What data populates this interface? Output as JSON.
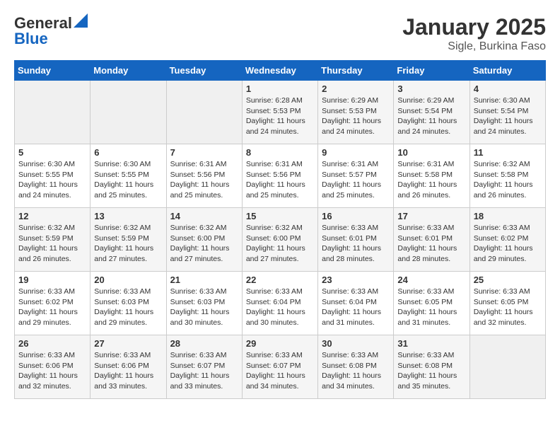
{
  "header": {
    "logo_line1": "General",
    "logo_line2": "Blue",
    "month": "January 2025",
    "location": "Sigle, Burkina Faso"
  },
  "days_of_week": [
    "Sunday",
    "Monday",
    "Tuesday",
    "Wednesday",
    "Thursday",
    "Friday",
    "Saturday"
  ],
  "weeks": [
    [
      {
        "day": "",
        "info": ""
      },
      {
        "day": "",
        "info": ""
      },
      {
        "day": "",
        "info": ""
      },
      {
        "day": "1",
        "info": "Sunrise: 6:28 AM\nSunset: 5:53 PM\nDaylight: 11 hours and 24 minutes."
      },
      {
        "day": "2",
        "info": "Sunrise: 6:29 AM\nSunset: 5:53 PM\nDaylight: 11 hours and 24 minutes."
      },
      {
        "day": "3",
        "info": "Sunrise: 6:29 AM\nSunset: 5:54 PM\nDaylight: 11 hours and 24 minutes."
      },
      {
        "day": "4",
        "info": "Sunrise: 6:30 AM\nSunset: 5:54 PM\nDaylight: 11 hours and 24 minutes."
      }
    ],
    [
      {
        "day": "5",
        "info": "Sunrise: 6:30 AM\nSunset: 5:55 PM\nDaylight: 11 hours and 24 minutes."
      },
      {
        "day": "6",
        "info": "Sunrise: 6:30 AM\nSunset: 5:55 PM\nDaylight: 11 hours and 25 minutes."
      },
      {
        "day": "7",
        "info": "Sunrise: 6:31 AM\nSunset: 5:56 PM\nDaylight: 11 hours and 25 minutes."
      },
      {
        "day": "8",
        "info": "Sunrise: 6:31 AM\nSunset: 5:56 PM\nDaylight: 11 hours and 25 minutes."
      },
      {
        "day": "9",
        "info": "Sunrise: 6:31 AM\nSunset: 5:57 PM\nDaylight: 11 hours and 25 minutes."
      },
      {
        "day": "10",
        "info": "Sunrise: 6:31 AM\nSunset: 5:58 PM\nDaylight: 11 hours and 26 minutes."
      },
      {
        "day": "11",
        "info": "Sunrise: 6:32 AM\nSunset: 5:58 PM\nDaylight: 11 hours and 26 minutes."
      }
    ],
    [
      {
        "day": "12",
        "info": "Sunrise: 6:32 AM\nSunset: 5:59 PM\nDaylight: 11 hours and 26 minutes."
      },
      {
        "day": "13",
        "info": "Sunrise: 6:32 AM\nSunset: 5:59 PM\nDaylight: 11 hours and 27 minutes."
      },
      {
        "day": "14",
        "info": "Sunrise: 6:32 AM\nSunset: 6:00 PM\nDaylight: 11 hours and 27 minutes."
      },
      {
        "day": "15",
        "info": "Sunrise: 6:32 AM\nSunset: 6:00 PM\nDaylight: 11 hours and 27 minutes."
      },
      {
        "day": "16",
        "info": "Sunrise: 6:33 AM\nSunset: 6:01 PM\nDaylight: 11 hours and 28 minutes."
      },
      {
        "day": "17",
        "info": "Sunrise: 6:33 AM\nSunset: 6:01 PM\nDaylight: 11 hours and 28 minutes."
      },
      {
        "day": "18",
        "info": "Sunrise: 6:33 AM\nSunset: 6:02 PM\nDaylight: 11 hours and 29 minutes."
      }
    ],
    [
      {
        "day": "19",
        "info": "Sunrise: 6:33 AM\nSunset: 6:02 PM\nDaylight: 11 hours and 29 minutes."
      },
      {
        "day": "20",
        "info": "Sunrise: 6:33 AM\nSunset: 6:03 PM\nDaylight: 11 hours and 29 minutes."
      },
      {
        "day": "21",
        "info": "Sunrise: 6:33 AM\nSunset: 6:03 PM\nDaylight: 11 hours and 30 minutes."
      },
      {
        "day": "22",
        "info": "Sunrise: 6:33 AM\nSunset: 6:04 PM\nDaylight: 11 hours and 30 minutes."
      },
      {
        "day": "23",
        "info": "Sunrise: 6:33 AM\nSunset: 6:04 PM\nDaylight: 11 hours and 31 minutes."
      },
      {
        "day": "24",
        "info": "Sunrise: 6:33 AM\nSunset: 6:05 PM\nDaylight: 11 hours and 31 minutes."
      },
      {
        "day": "25",
        "info": "Sunrise: 6:33 AM\nSunset: 6:05 PM\nDaylight: 11 hours and 32 minutes."
      }
    ],
    [
      {
        "day": "26",
        "info": "Sunrise: 6:33 AM\nSunset: 6:06 PM\nDaylight: 11 hours and 32 minutes."
      },
      {
        "day": "27",
        "info": "Sunrise: 6:33 AM\nSunset: 6:06 PM\nDaylight: 11 hours and 33 minutes."
      },
      {
        "day": "28",
        "info": "Sunrise: 6:33 AM\nSunset: 6:07 PM\nDaylight: 11 hours and 33 minutes."
      },
      {
        "day": "29",
        "info": "Sunrise: 6:33 AM\nSunset: 6:07 PM\nDaylight: 11 hours and 34 minutes."
      },
      {
        "day": "30",
        "info": "Sunrise: 6:33 AM\nSunset: 6:08 PM\nDaylight: 11 hours and 34 minutes."
      },
      {
        "day": "31",
        "info": "Sunrise: 6:33 AM\nSunset: 6:08 PM\nDaylight: 11 hours and 35 minutes."
      },
      {
        "day": "",
        "info": ""
      }
    ]
  ]
}
